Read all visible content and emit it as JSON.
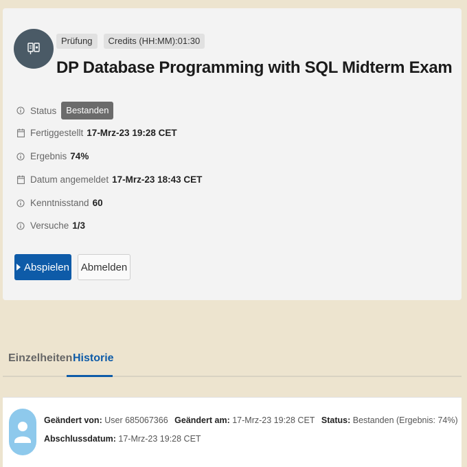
{
  "course": {
    "icon": "exam-icon",
    "type_badge": "Prüfung",
    "credits_badge": "Credits (HH:MM):01:30",
    "title": "DP Database Programming with SQL Midterm Exam"
  },
  "meta": {
    "status_label": "Status",
    "status_value": "Bestanden",
    "completed_label": "Fertiggestellt",
    "completed_value": "17-Mrz-23 19:28 CET",
    "result_label": "Ergebnis",
    "result_value": "74%",
    "registered_label": "Datum angemeldet",
    "registered_value": "17-Mrz-23 18:43 CET",
    "proficiency_label": "Kenntnisstand",
    "proficiency_value": "60",
    "attempts_label": "Versuche",
    "attempts_value": "1/3"
  },
  "actions": {
    "play_label": "Abspielen",
    "unregister_label": "Abmelden"
  },
  "tabs": [
    {
      "label": "Einzelheiten",
      "active": false
    },
    {
      "label": "Historie",
      "active": true
    }
  ],
  "history": {
    "changed_by_label": "Geändert von:",
    "changed_by_value": "User 685067366",
    "changed_at_label": "Geändert am:",
    "changed_at_value": "17-Mrz-23 19:28 CET",
    "status_label": "Status:",
    "status_value": "Bestanden (Ergebnis: 74%)",
    "completion_label": "Abschlussdatum:",
    "completion_value": "17-Mrz-23 19:28 CET"
  },
  "colors": {
    "background": "#ede4cf",
    "primary": "#0e5ba8",
    "icon_circle": "#4a5a66",
    "avatar": "#8ec9ec",
    "status_pill": "#6b6b6b"
  }
}
